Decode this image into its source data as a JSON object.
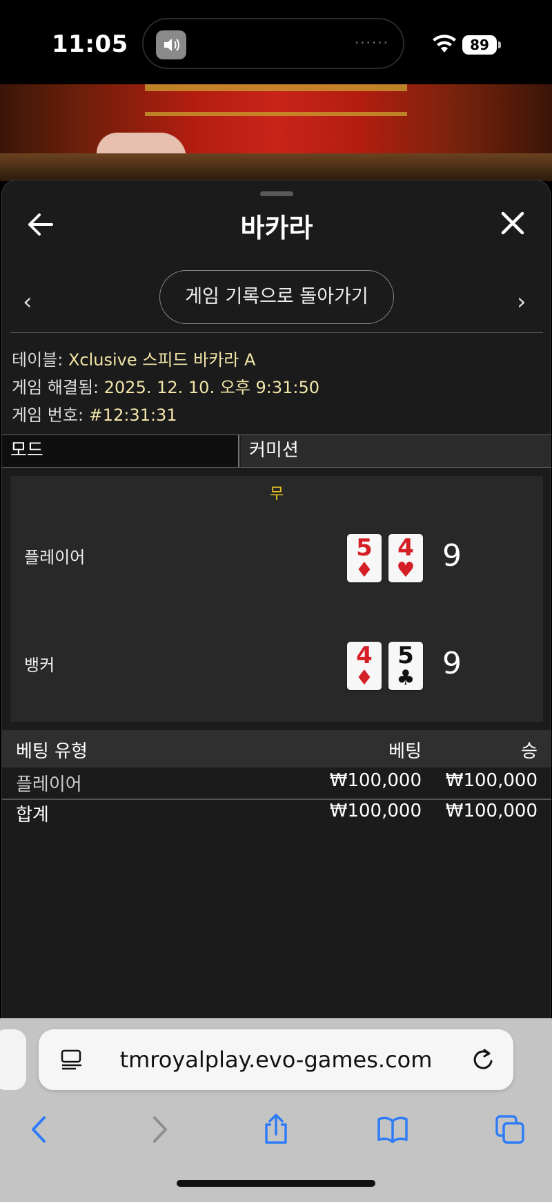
{
  "status_bar": {
    "time": "11:05",
    "battery": "89"
  },
  "sheet": {
    "title": "바카라",
    "history_button": "게임 기록으로 돌아가기",
    "info": {
      "table_label": "테이블:",
      "table_value": "Xclusive 스피드 바카라 A",
      "resolved_label": "게임 해결됨:",
      "resolved_value": "2025. 12. 10. 오후 9:31:50",
      "game_no_label": "게임 번호:",
      "game_no_value": "#12:31:31"
    },
    "mode": {
      "label": "모드",
      "value": "커미션"
    },
    "result": {
      "outcome": "무",
      "player": {
        "label": "플레이어",
        "cards": [
          {
            "rank": "5",
            "suit": "♦",
            "color": "red"
          },
          {
            "rank": "4",
            "suit": "♥",
            "color": "red"
          }
        ],
        "score": "9"
      },
      "banker": {
        "label": "뱅커",
        "cards": [
          {
            "rank": "4",
            "suit": "♦",
            "color": "red"
          },
          {
            "rank": "5",
            "suit": "♣",
            "color": "black"
          }
        ],
        "score": "9"
      }
    },
    "bets": {
      "headers": {
        "type": "베팅 유형",
        "bet": "베팅",
        "win": "승"
      },
      "rows": [
        {
          "type": "플레이어",
          "bet": "₩100,000",
          "win": "₩100,000"
        }
      ],
      "total": {
        "type": "합계",
        "bet": "₩100,000",
        "win": "₩100,000"
      }
    }
  },
  "browser": {
    "url": "tmroyalplay.evo-games.com"
  },
  "colors": {
    "accent_yellow": "#e7c321",
    "info_value": "#f2e5a8",
    "ios_blue": "#2f7cf6"
  }
}
